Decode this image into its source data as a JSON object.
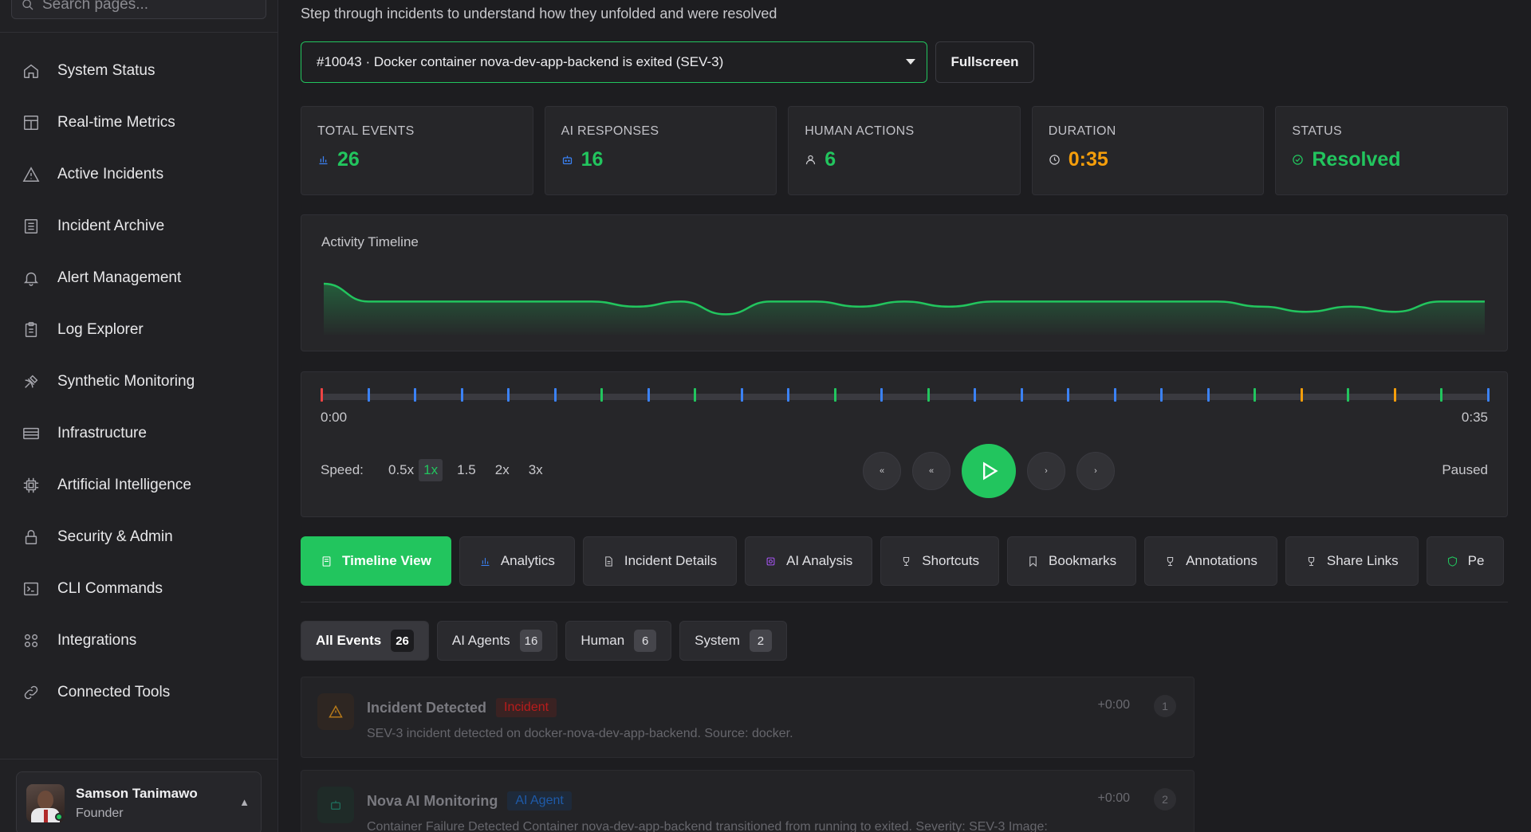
{
  "sidebar": {
    "search_placeholder": "Search pages...",
    "items": [
      {
        "label": "System Status",
        "icon": "home-icon"
      },
      {
        "label": "Real-time Metrics",
        "icon": "layout-icon"
      },
      {
        "label": "Active Incidents",
        "icon": "warning-icon"
      },
      {
        "label": "Incident Archive",
        "icon": "archive-icon"
      },
      {
        "label": "Alert Management",
        "icon": "bell-icon"
      },
      {
        "label": "Log Explorer",
        "icon": "clipboard-icon"
      },
      {
        "label": "Synthetic Monitoring",
        "icon": "satellite-icon"
      },
      {
        "label": "Infrastructure",
        "icon": "server-icon"
      },
      {
        "label": "Artificial Intelligence",
        "icon": "cpu-icon"
      },
      {
        "label": "Security & Admin",
        "icon": "lock-icon"
      },
      {
        "label": "CLI Commands",
        "icon": "terminal-icon"
      },
      {
        "label": "Integrations",
        "icon": "grid-icon"
      },
      {
        "label": "Connected Tools",
        "icon": "link-icon"
      }
    ],
    "user": {
      "name": "Samson Tanimawo",
      "role": "Founder",
      "caret": "▲"
    }
  },
  "header": {
    "subtitle": "Step through incidents to understand how they unfolded and were resolved",
    "incident_select": "#10043 · Docker container nova-dev-app-backend is exited (SEV-3)",
    "fullscreen_label": "Fullscreen"
  },
  "stats": [
    {
      "label": "TOTAL EVENTS",
      "value": "26",
      "color": "#22c55e",
      "icon": "bar-chart-icon"
    },
    {
      "label": "AI RESPONSES",
      "value": "16",
      "color": "#22c55e",
      "icon": "robot-icon"
    },
    {
      "label": "HUMAN ACTIONS",
      "value": "6",
      "color": "#22c55e",
      "icon": "user-icon"
    },
    {
      "label": "DURATION",
      "value": "0:35",
      "color": "#f59e0b",
      "icon": "clock-icon"
    },
    {
      "label": "STATUS",
      "value": "Resolved",
      "color": "#22c55e",
      "icon": "check-circle-icon"
    }
  ],
  "activity": {
    "title": "Activity Timeline",
    "values": [
      4,
      2.6,
      2.6,
      2.6,
      2.6,
      2.6,
      2.6,
      2.2,
      2.6,
      1.6,
      2.6,
      2.6,
      2.2,
      2.6,
      2.2,
      2.6,
      2.6,
      2.6,
      2.6,
      2.6,
      2.6,
      2.2,
      1.8,
      2.2,
      1.8,
      2.6,
      2.6
    ],
    "color": "#22c55e"
  },
  "player": {
    "start": "0:00",
    "end": "0:35",
    "speed_label": "Speed:",
    "speeds": [
      "0.5x",
      "1x",
      "1.5",
      "2x",
      "3x"
    ],
    "active_speed": "1x",
    "status": "Paused",
    "event_types": [
      "incident",
      "ai",
      "ai",
      "ai",
      "ai",
      "ai",
      "human",
      "ai",
      "human",
      "ai",
      "ai",
      "human",
      "ai",
      "human",
      "ai",
      "ai",
      "ai",
      "ai",
      "ai",
      "ai",
      "human",
      "warn",
      "human",
      "warn",
      "human",
      "ai"
    ],
    "type_colors": {
      "incident": "#ef4444",
      "ai": "#3b82f6",
      "human": "#22c55e",
      "warn": "#f59e0b"
    }
  },
  "tabs": [
    {
      "label": "Timeline View",
      "icon": "document-icon",
      "color": "#ffffff",
      "active": true
    },
    {
      "label": "Analytics",
      "icon": "bar-chart-icon",
      "color": "#3b82f6"
    },
    {
      "label": "Incident Details",
      "icon": "file-icon",
      "color": "#c8c8cc"
    },
    {
      "label": "AI Analysis",
      "icon": "ai-chip-icon",
      "color": "#a855f7"
    },
    {
      "label": "Shortcuts",
      "icon": "trophy-icon",
      "color": "#c8c8cc"
    },
    {
      "label": "Bookmarks",
      "icon": "bookmark-icon",
      "color": "#c8c8cc"
    },
    {
      "label": "Annotations",
      "icon": "trophy-icon",
      "color": "#c8c8cc"
    },
    {
      "label": "Share Links",
      "icon": "trophy-icon",
      "color": "#c8c8cc"
    },
    {
      "label": "Pe",
      "icon": "shield-icon",
      "color": "#22c55e"
    }
  ],
  "filters": [
    {
      "label": "All Events",
      "count": "26",
      "active": true
    },
    {
      "label": "AI Agents",
      "count": "16"
    },
    {
      "label": "Human",
      "count": "6"
    },
    {
      "label": "System",
      "count": "2"
    }
  ],
  "events": [
    {
      "title": "Incident Detected",
      "tag": "Incident",
      "tag_color": "#b91c1c",
      "desc": "SEV-3 incident detected on docker-nova-dev-app-backend. Source: docker.",
      "time": "+0:00",
      "num": "1",
      "icon": "warning-icon",
      "icon_color": "#b4781a"
    },
    {
      "title": "Nova AI Monitoring",
      "tag": "AI Agent",
      "tag_color": "#1e5aa8",
      "desc": "Container Failure Detected Container nova-dev-app-backend transitioned from running to exited. Severity: SEV-3 Image:",
      "time": "+0:00",
      "num": "2",
      "icon": "robot-icon",
      "icon_color": "#1f6b5a"
    }
  ]
}
